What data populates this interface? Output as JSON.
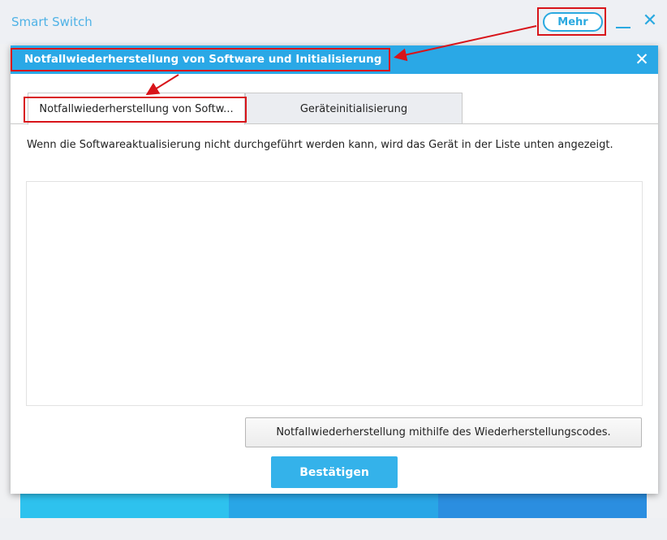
{
  "app": {
    "title": "Smart Switch",
    "more_label": "Mehr"
  },
  "dialog": {
    "title": "Notfallwiederherstellung von Software und Initialisierung",
    "tabs": [
      {
        "label": "Notfallwiederherstellung von Softw...",
        "active": true
      },
      {
        "label": "Geräteinitialisierung",
        "active": false
      }
    ],
    "description": "Wenn die Softwareaktualisierung nicht durchgeführt werden kann, wird das Gerät in der Liste unten angezeigt.",
    "device_list": [],
    "recovery_code_button_label": "Notfallwiederherstellung mithilfe des Wiederherstellungscodes.",
    "confirm_label": "Bestätigen"
  },
  "colors": {
    "accent": "#2aa8e6",
    "annotation": "#d8141a"
  }
}
